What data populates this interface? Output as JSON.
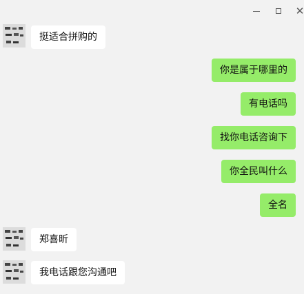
{
  "window": {
    "minimize_glyph": "",
    "maximize_glyph": "",
    "close_glyph": "✕"
  },
  "messages": [
    {
      "side": "left",
      "text": "挺适合拼购的"
    },
    {
      "side": "right",
      "text": "你是属于哪里的"
    },
    {
      "side": "right",
      "text": "有电话吗"
    },
    {
      "side": "right",
      "text": "找你电话咨询下"
    },
    {
      "side": "right",
      "text": "你全民叫什么"
    },
    {
      "side": "right",
      "text": "全名"
    },
    {
      "side": "left",
      "text": "郑喜昕"
    },
    {
      "side": "left",
      "text": "我电话跟您沟通吧"
    }
  ],
  "colors": {
    "background": "#f2f2f2",
    "outgoing_bubble": "#95ec69",
    "incoming_bubble": "#ffffff"
  },
  "icons": {
    "minimize": "minimize-icon",
    "maximize": "maximize-icon",
    "close": "close-icon",
    "avatar": "contact-avatar"
  }
}
